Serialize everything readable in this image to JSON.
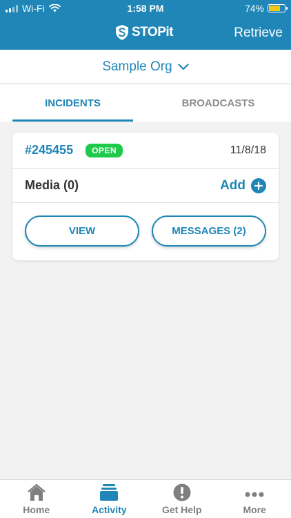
{
  "status_bar": {
    "carrier": "Wi-Fi",
    "time": "1:58 PM",
    "battery_percent_label": "74%",
    "battery_level": 0.74
  },
  "header": {
    "brand": "STOPit",
    "retrieve_label": "Retrieve"
  },
  "org_selector": {
    "label": "Sample Org"
  },
  "tabs": [
    {
      "label": "INCIDENTS",
      "active": true
    },
    {
      "label": "BROADCASTS",
      "active": false
    }
  ],
  "incident": {
    "id": "#245455",
    "status": "OPEN",
    "date": "11/8/18",
    "media_label": "Media (0)",
    "add_label": "Add",
    "view_label": "VIEW",
    "messages_label": "MESSAGES (2)"
  },
  "bottom_nav": [
    {
      "label": "Home",
      "icon": "home-icon",
      "active": false
    },
    {
      "label": "Activity",
      "icon": "activity-icon",
      "active": true
    },
    {
      "label": "Get Help",
      "icon": "get-help-icon",
      "active": false
    },
    {
      "label": "More",
      "icon": "more-icon",
      "active": false
    }
  ],
  "colors": {
    "primary": "#1f86b7",
    "open_badge": "#1fc94a",
    "battery": "#f5c518",
    "inactive": "#7f7f7f"
  }
}
